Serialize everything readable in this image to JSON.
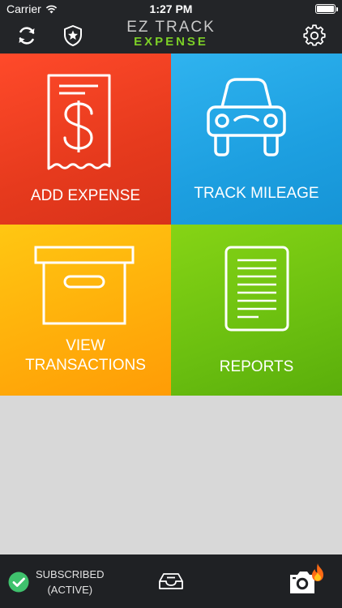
{
  "status_bar": {
    "carrier": "Carrier",
    "time": "1:27 PM"
  },
  "header": {
    "logo_line1": "EZ TRACK",
    "logo_line2": "EXPENSE",
    "icons": [
      "sync-icon",
      "shield-star-icon",
      "gear-icon"
    ]
  },
  "tiles": [
    {
      "label": "ADD EXPENSE",
      "icon": "receipt-dollar-icon",
      "color": "#ef3f22"
    },
    {
      "label": "TRACK MILEAGE",
      "icon": "car-icon",
      "color": "#22a6e6"
    },
    {
      "label_line1": "VIEW",
      "label_line2": "TRANSACTIONS",
      "icon": "archive-box-icon",
      "color": "#ffb30c"
    },
    {
      "label": "REPORTS",
      "icon": "document-icon",
      "color": "#71c412"
    }
  ],
  "footer": {
    "subscription_line1": "SUBSCRIBED",
    "subscription_line2": "(ACTIVE)",
    "status_color": "#3fc26d",
    "icons": [
      "check-circle-icon",
      "inbox-icon",
      "camera-icon",
      "fire-icon"
    ]
  },
  "colors": {
    "bar_background": "#232528",
    "accent_green": "#7ccf27",
    "content_background": "#d8d8d8"
  }
}
